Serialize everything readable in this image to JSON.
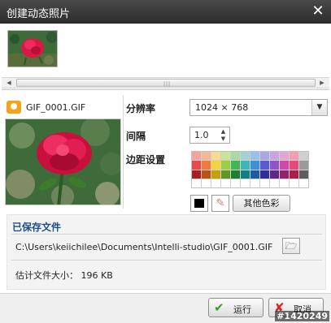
{
  "window": {
    "title": "创建动态照片"
  },
  "file": {
    "name": "GIF_0001.GIF"
  },
  "settings": {
    "resolution_label": "分辨率",
    "resolution_value": "1024 × 768",
    "interval_label": "间隔",
    "interval_value": "1.0",
    "border_label": "边距设置",
    "other_colors_label": "其他色彩",
    "current_color": "#000000",
    "palette": [
      "#f4a39a",
      "#f5b893",
      "#f7dc8f",
      "#c8e59a",
      "#a7dba5",
      "#9fd3d6",
      "#95c2ea",
      "#a8a8e6",
      "#c7a3e1",
      "#e7a3d1",
      "#f29db4",
      "#cfcfcf",
      "#e8494b",
      "#ee7a3c",
      "#f4d33d",
      "#98cf45",
      "#44b553",
      "#3fb6b6",
      "#3e8fd8",
      "#5a5ad1",
      "#9154c8",
      "#cf4aa8",
      "#e8497b",
      "#9a9a9a",
      "#a41e22",
      "#b85413",
      "#c4a20e",
      "#5f9722",
      "#1f7e33",
      "#137f84",
      "#1c5ea1",
      "#2e2f95",
      "#5e2a88",
      "#93226e",
      "#a91f4a",
      "#5d5d5d",
      "#ffffff",
      "#ffffff",
      "#ffffff",
      "#ffffff",
      "#ffffff",
      "#ffffff",
      "#ffffff",
      "#ffffff",
      "#ffffff",
      "#ffffff",
      "#ffffff",
      "#ffffff"
    ]
  },
  "saved": {
    "title": "已保存文件",
    "path": "C:\\Users\\keiichilee\\Documents\\Intelli-studio\\GIF_0001.GIF",
    "size_text": "估计文件大小： 196 KB"
  },
  "buttons": {
    "ok": "运行",
    "cancel": "取消"
  },
  "watermark": "#1420249"
}
